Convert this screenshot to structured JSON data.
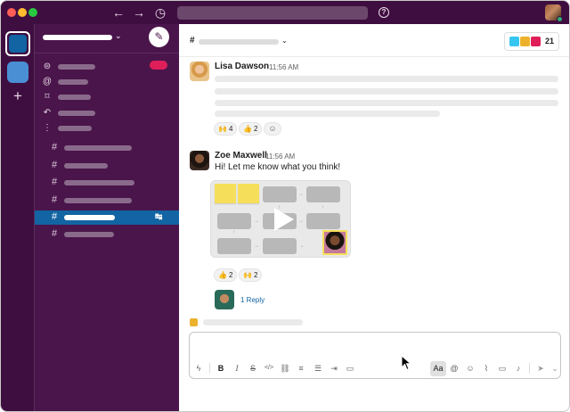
{
  "app": {
    "colors": {
      "sidebar": "#4a154b",
      "titlebar": "#3f0e40",
      "active_channel": "#1264a3",
      "mention_badge": "#e01e5a",
      "presence": "#2bac76"
    }
  },
  "titlebar": {
    "back_icon": "←",
    "forward_icon": "→",
    "history_icon": "◷",
    "help_icon": "?"
  },
  "rail": {
    "add_label": "+"
  },
  "sidebar": {
    "workspace_chevron": "⌄",
    "compose_icon": "✎",
    "nav_icons": [
      "threads-icon",
      "mentions-icon",
      "saved-icon",
      "channels-browse-icon",
      "more-icon"
    ],
    "nav_glyphs": [
      "⊜",
      "@",
      "⌑",
      "↶",
      "⋮"
    ],
    "channel_hash": "#",
    "active_channel_index": 4,
    "active_channel_link": "↹"
  },
  "main": {
    "header": {
      "hash": "#",
      "chevron": "⌄",
      "member_count": "21"
    },
    "messages": [
      {
        "sender": "Lisa Dawson",
        "time": "11:56 AM",
        "text": "",
        "reactions": [
          {
            "emoji": "🙌",
            "count": "4"
          },
          {
            "emoji": "👍",
            "count": "2"
          }
        ],
        "add_reaction_icon": "☺"
      },
      {
        "sender": "Zoe Maxwell",
        "time": "11:56 AM",
        "text": "Hi! Let me know what you think!",
        "reactions": [
          {
            "emoji": "👍",
            "count": "2"
          },
          {
            "emoji": "🙌",
            "count": "2"
          }
        ],
        "thread": {
          "label": "1 Reply"
        }
      }
    ],
    "composer": {
      "value": "",
      "placeholder": "",
      "toolbar": {
        "lightning": "ϟ",
        "bold": "B",
        "italic": "I",
        "strike": "S",
        "code": "</>",
        "link": "⛓",
        "ordered_list": "≡",
        "bulleted_list": "☰",
        "indent": "⇥",
        "code_block": "▭",
        "format": "Aa",
        "mention": "@",
        "emoji": "☺",
        "attach": "⌇",
        "video": "▭",
        "audio": "♪",
        "send": "➤",
        "send_options": "⌄"
      }
    }
  }
}
